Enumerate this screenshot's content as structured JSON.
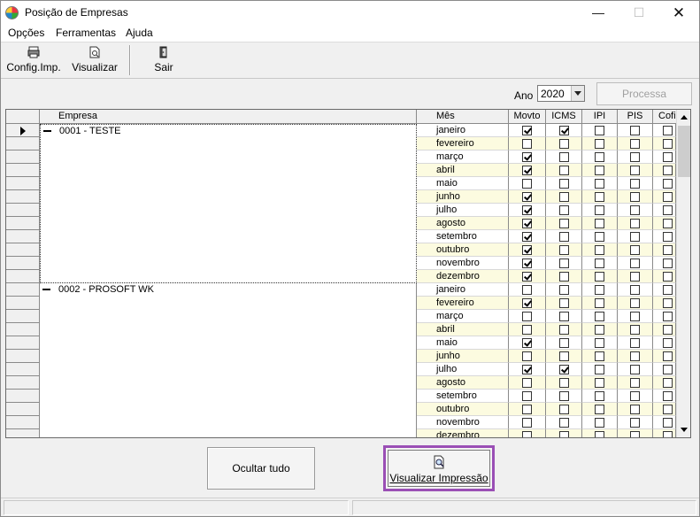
{
  "window": {
    "title": "Posição de Empresas"
  },
  "menu": [
    "Opções",
    "Ferramentas",
    "Ajuda"
  ],
  "toolbar": {
    "config_label": "Config.Imp.",
    "visualizar_label": "Visualizar",
    "sair_label": "Sair"
  },
  "filters": {
    "ano_label": "Ano",
    "ano_value": "2020",
    "processa_label": "Processa"
  },
  "grid": {
    "headers": [
      "Empresa",
      "Mês",
      "Movto",
      "ICMS",
      "IPI",
      "PIS",
      "Cofi"
    ],
    "companies": [
      {
        "name": "0001 - TESTE",
        "months": [
          {
            "mes": "janeiro",
            "checks": [
              true,
              true,
              false,
              false,
              false
            ]
          },
          {
            "mes": "fevereiro",
            "checks": [
              false,
              false,
              false,
              false,
              false
            ]
          },
          {
            "mes": "março",
            "checks": [
              true,
              false,
              false,
              false,
              false
            ]
          },
          {
            "mes": "abril",
            "checks": [
              true,
              false,
              false,
              false,
              false
            ]
          },
          {
            "mes": "maio",
            "checks": [
              false,
              false,
              false,
              false,
              false
            ]
          },
          {
            "mes": "junho",
            "checks": [
              true,
              false,
              false,
              false,
              false
            ]
          },
          {
            "mes": "julho",
            "checks": [
              true,
              false,
              false,
              false,
              false
            ]
          },
          {
            "mes": "agosto",
            "checks": [
              true,
              false,
              false,
              false,
              false
            ]
          },
          {
            "mes": "setembro",
            "checks": [
              true,
              false,
              false,
              false,
              false
            ]
          },
          {
            "mes": "outubro",
            "checks": [
              true,
              false,
              false,
              false,
              false
            ]
          },
          {
            "mes": "novembro",
            "checks": [
              true,
              false,
              false,
              false,
              false
            ]
          },
          {
            "mes": "dezembro",
            "checks": [
              true,
              false,
              false,
              false,
              false
            ]
          }
        ]
      },
      {
        "name": "0002 - PROSOFT WK",
        "months": [
          {
            "mes": "janeiro",
            "checks": [
              false,
              false,
              false,
              false,
              false
            ]
          },
          {
            "mes": "fevereiro",
            "checks": [
              true,
              false,
              false,
              false,
              false
            ]
          },
          {
            "mes": "março",
            "checks": [
              false,
              false,
              false,
              false,
              false
            ]
          },
          {
            "mes": "abril",
            "checks": [
              false,
              false,
              false,
              false,
              false
            ]
          },
          {
            "mes": "maio",
            "checks": [
              true,
              false,
              false,
              false,
              false
            ]
          },
          {
            "mes": "junho",
            "checks": [
              false,
              false,
              false,
              false,
              false
            ]
          },
          {
            "mes": "julho",
            "checks": [
              true,
              true,
              false,
              false,
              false
            ]
          },
          {
            "mes": "agosto",
            "checks": [
              false,
              false,
              false,
              false,
              false
            ]
          },
          {
            "mes": "setembro",
            "checks": [
              false,
              false,
              false,
              false,
              false
            ]
          },
          {
            "mes": "outubro",
            "checks": [
              false,
              false,
              false,
              false,
              false
            ]
          },
          {
            "mes": "novembro",
            "checks": [
              false,
              false,
              false,
              false,
              false
            ]
          },
          {
            "mes": "dezembro",
            "checks": [
              false,
              false,
              false,
              false,
              false
            ]
          }
        ]
      }
    ]
  },
  "actions": {
    "ocultar_label": "Ocultar tudo",
    "visualizar_impressao_label": "Visualizar Impressão"
  },
  "colors": {
    "accent_border": "#9a4fb5",
    "alt_row": "#fcfbe0"
  }
}
